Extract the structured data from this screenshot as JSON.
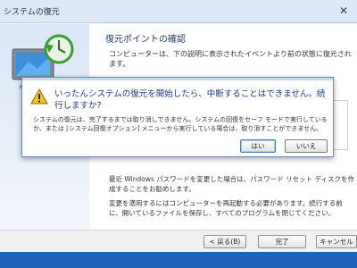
{
  "window": {
    "title": "システムの復元",
    "close_glyph": "✕"
  },
  "wizard": {
    "heading": "復元ポイントの確認",
    "description": "コンピューターは、下の説明に表示されたイベントより前の状態に復元されます。",
    "note_password": "最近 Windows パスワードを変更した場合は、パスワード リセット ディスクを作成することをお勧めします。",
    "note_restart": "変更を適用するにはコンピューターを再起動する必要があります。続行する前に、開いているファイルを保存し、すべてのプログラムを閉じてください。"
  },
  "footer": {
    "back_label": "< 戻る(B)",
    "finish_label": "完了",
    "cancel_label": "キャンセル"
  },
  "dialog": {
    "main_instruction": "いったんシステムの復元を開始したら、中断することはできません。続行しますか?",
    "content": "システムの復元は、完了するまでは取り消しできません。システムの回復をセーフ モードで実行しているか、または [システム回復オプション] メニューから実行している場合は、取り消すことができません。",
    "yes_label": "はい",
    "no_label": "いいえ"
  },
  "colors": {
    "desktop": "#1f6fc4",
    "heading": "#1f3a72",
    "main_instruction": "#1b3a8a",
    "warning": "#f4c430"
  }
}
